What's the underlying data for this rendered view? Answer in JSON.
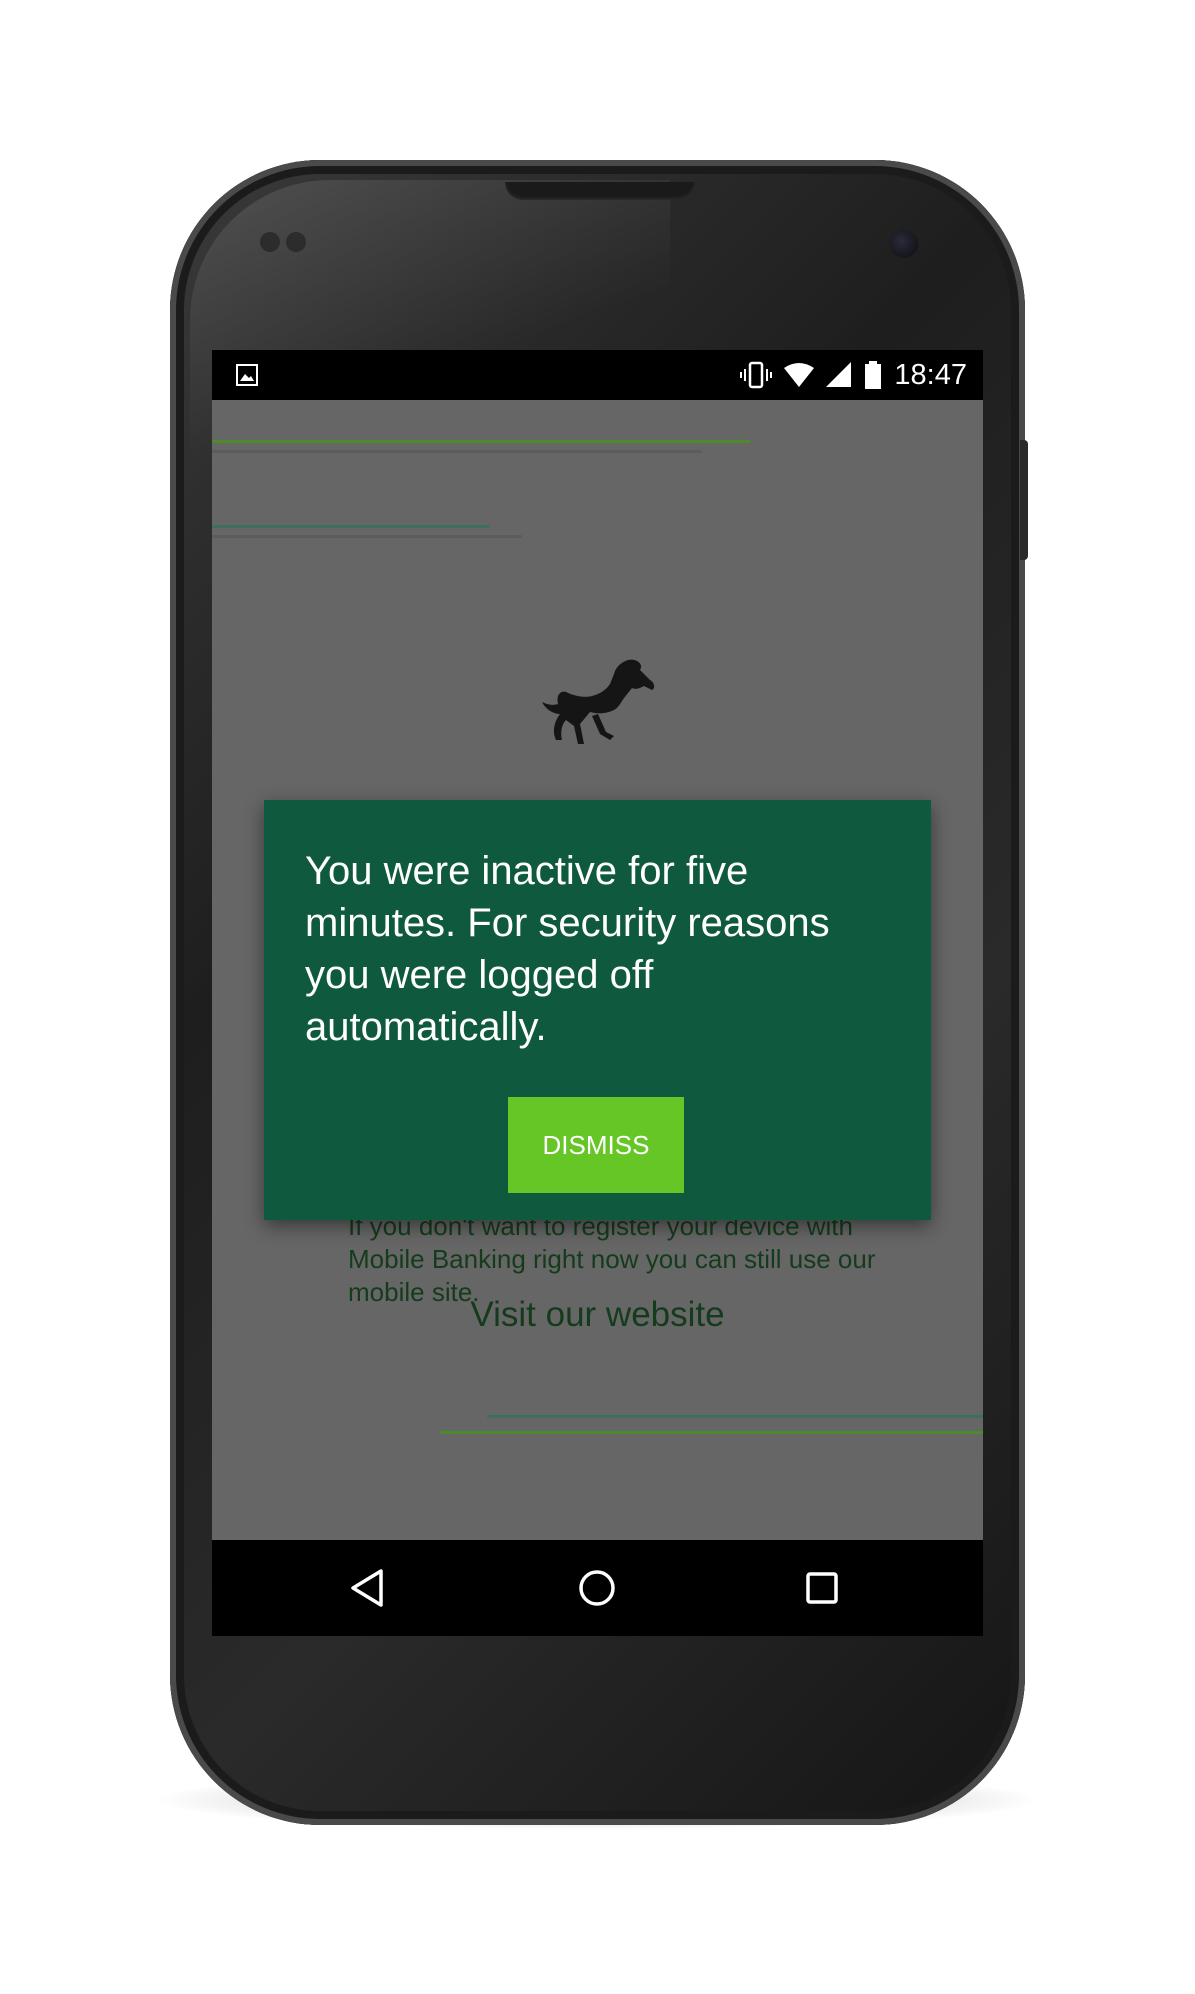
{
  "status_bar": {
    "time": "18:47",
    "icons": [
      "image-icon",
      "vibrate-icon",
      "wifi-icon",
      "signal-icon",
      "battery-icon"
    ]
  },
  "app": {
    "subtext": "If you don't want to register your device with Mobile Banking right now you can still use our mobile site.",
    "visit_link": "Visit our website"
  },
  "dialog": {
    "message": "You were inactive for five minutes. For security reasons you were logged off automatically.",
    "dismiss_label": "DISMISS"
  },
  "nav_bar": {
    "buttons": [
      "back-icon",
      "home-icon",
      "recents-icon"
    ]
  },
  "colors": {
    "dialog_background": "#0f5a3e",
    "dismiss_button": "#66c626",
    "screen_overlay": "#666666",
    "accent_line_green": "#4f8a2a",
    "accent_line_teal": "#3e6e62"
  }
}
